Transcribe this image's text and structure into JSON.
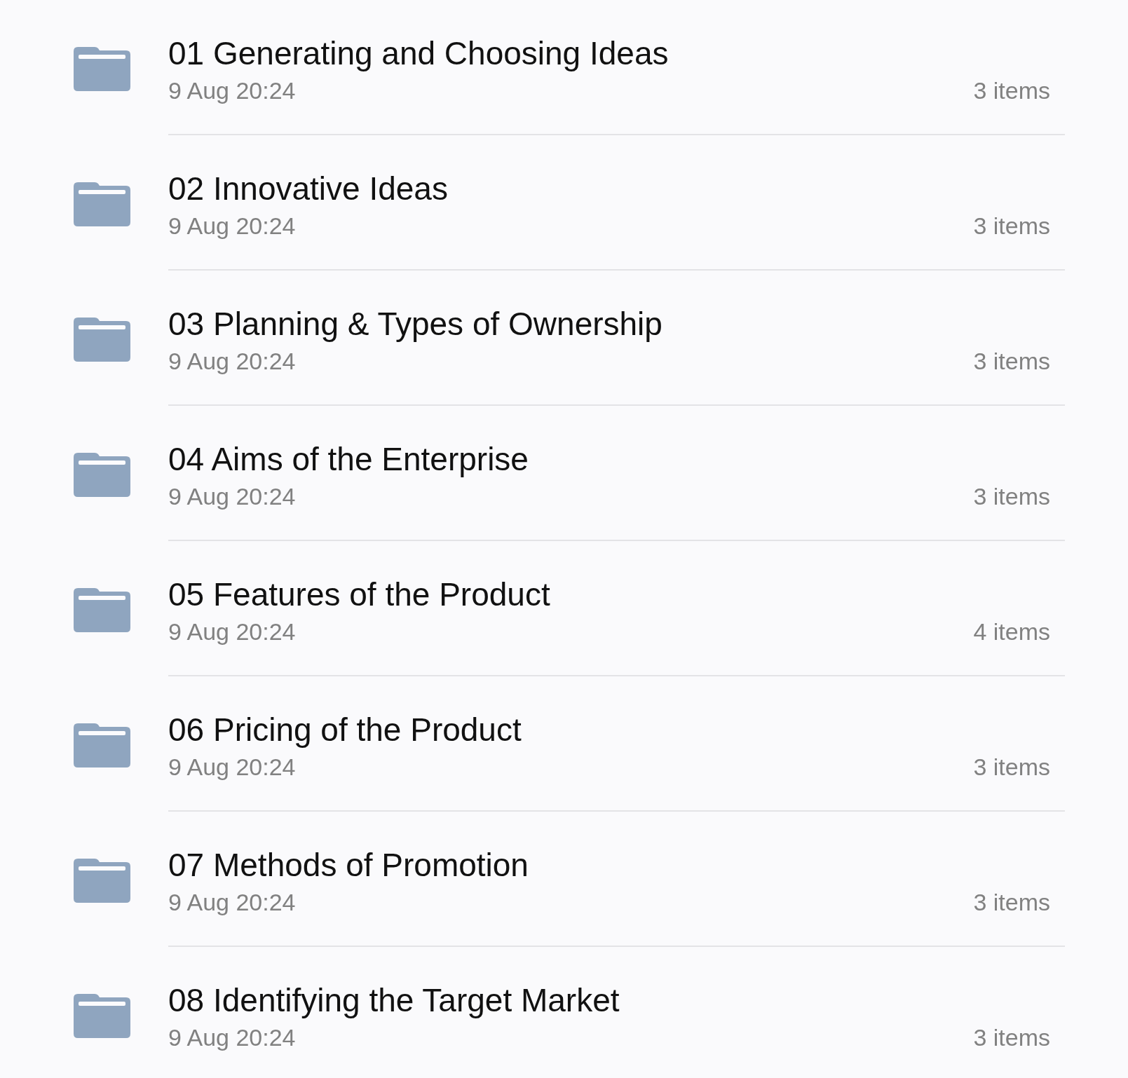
{
  "folders": [
    {
      "name": "01 Generating and Choosing Ideas",
      "modified": "9 Aug 20:24",
      "count": "3 items"
    },
    {
      "name": "02 Innovative Ideas",
      "modified": "9 Aug 20:24",
      "count": "3 items"
    },
    {
      "name": "03 Planning & Types of Ownership",
      "modified": "9 Aug 20:24",
      "count": "3 items"
    },
    {
      "name": "04 Aims of the Enterprise",
      "modified": "9 Aug 20:24",
      "count": "3 items"
    },
    {
      "name": "05 Features of the Product",
      "modified": "9 Aug 20:24",
      "count": "4 items"
    },
    {
      "name": "06 Pricing of the Product",
      "modified": "9 Aug 20:24",
      "count": "3 items"
    },
    {
      "name": "07 Methods of Promotion",
      "modified": "9 Aug 20:24",
      "count": "3 items"
    },
    {
      "name": "08 Identifying the Target Market",
      "modified": "9 Aug 20:24",
      "count": "3 items"
    }
  ]
}
